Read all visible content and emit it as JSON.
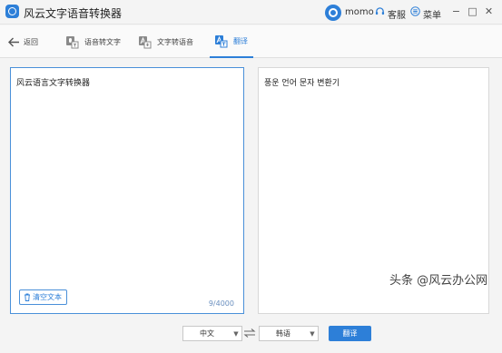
{
  "app": {
    "title": "风云文字语音转换器"
  },
  "user": {
    "name": "momo"
  },
  "header": {
    "service_label": "客服",
    "menu_label": "菜单"
  },
  "window_controls": {
    "minimize": "−",
    "maximize": "□",
    "close": "✕"
  },
  "nav": {
    "back_label": "返回",
    "tabs": [
      {
        "label": "语音转文字",
        "icon": "speech-to-text-icon"
      },
      {
        "label": "文字转语音",
        "icon": "text-to-speech-icon"
      },
      {
        "label": "翻译",
        "icon": "translate-icon",
        "active": true
      }
    ]
  },
  "source": {
    "text": "风云语言文字转换器",
    "clear_label": "清空文本",
    "counter": "9/4000"
  },
  "target": {
    "text": "풍운 언어 문자 변환기"
  },
  "controls": {
    "source_lang": "中文",
    "target_lang": "韩语",
    "translate_label": "翻译"
  },
  "watermark": {
    "text": "头条 @风云办公网"
  },
  "colors": {
    "accent": "#2d7fd8",
    "panel_border": "#4a90d9",
    "background": "#f4f4f4"
  }
}
